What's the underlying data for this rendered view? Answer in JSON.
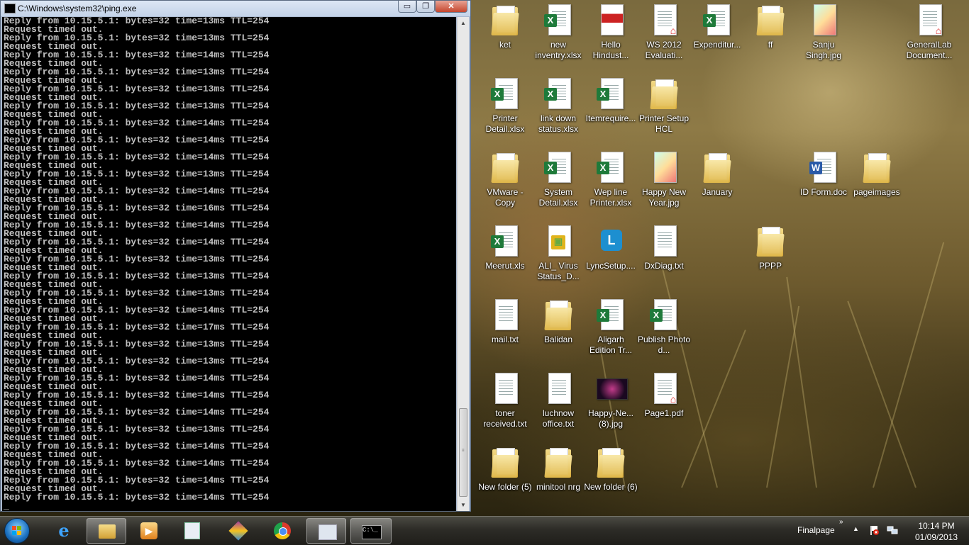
{
  "console": {
    "title": "C:\\Windows\\system32\\ping.exe",
    "buttons": {
      "minimize": "▭",
      "maximize": "❐",
      "close": "✕"
    },
    "output_lines": [
      "Reply from 10.15.5.1: bytes=32 time=13ms TTL=254",
      "Request timed out.",
      "Reply from 10.15.5.1: bytes=32 time=13ms TTL=254",
      "Request timed out.",
      "Reply from 10.15.5.1: bytes=32 time=14ms TTL=254",
      "Request timed out.",
      "Reply from 10.15.5.1: bytes=32 time=13ms TTL=254",
      "Request timed out.",
      "Reply from 10.15.5.1: bytes=32 time=13ms TTL=254",
      "Request timed out.",
      "Reply from 10.15.5.1: bytes=32 time=13ms TTL=254",
      "Request timed out.",
      "Reply from 10.15.5.1: bytes=32 time=14ms TTL=254",
      "Request timed out.",
      "Reply from 10.15.5.1: bytes=32 time=14ms TTL=254",
      "Request timed out.",
      "Reply from 10.15.5.1: bytes=32 time=14ms TTL=254",
      "Request timed out.",
      "Reply from 10.15.5.1: bytes=32 time=13ms TTL=254",
      "Request timed out.",
      "Reply from 10.15.5.1: bytes=32 time=14ms TTL=254",
      "Request timed out.",
      "Reply from 10.15.5.1: bytes=32 time=16ms TTL=254",
      "Request timed out.",
      "Reply from 10.15.5.1: bytes=32 time=14ms TTL=254",
      "Request timed out.",
      "Reply from 10.15.5.1: bytes=32 time=14ms TTL=254",
      "Request timed out.",
      "Reply from 10.15.5.1: bytes=32 time=13ms TTL=254",
      "Request timed out.",
      "Reply from 10.15.5.1: bytes=32 time=13ms TTL=254",
      "Request timed out.",
      "Reply from 10.15.5.1: bytes=32 time=13ms TTL=254",
      "Request timed out.",
      "Reply from 10.15.5.1: bytes=32 time=14ms TTL=254",
      "Request timed out.",
      "Reply from 10.15.5.1: bytes=32 time=17ms TTL=254",
      "Request timed out.",
      "Reply from 10.15.5.1: bytes=32 time=13ms TTL=254",
      "Request timed out.",
      "Reply from 10.15.5.1: bytes=32 time=13ms TTL=254",
      "Request timed out.",
      "Reply from 10.15.5.1: bytes=32 time=14ms TTL=254",
      "Request timed out.",
      "Reply from 10.15.5.1: bytes=32 time=14ms TTL=254",
      "Request timed out.",
      "Reply from 10.15.5.1: bytes=32 time=14ms TTL=254",
      "Request timed out.",
      "Reply from 10.15.5.1: bytes=32 time=13ms TTL=254",
      "Request timed out.",
      "Reply from 10.15.5.1: bytes=32 time=14ms TTL=254",
      "Request timed out.",
      "Reply from 10.15.5.1: bytes=32 time=14ms TTL=254",
      "Request timed out.",
      "Reply from 10.15.5.1: bytes=32 time=14ms TTL=254",
      "Request timed out.",
      "Reply from 10.15.5.1: bytes=32 time=14ms TTL=254",
      "_"
    ]
  },
  "desktop_icons": [
    {
      "label": "ket",
      "type": "folder"
    },
    {
      "label": "new inventry.xlsx",
      "type": "excel"
    },
    {
      "label": "Hello Hindust...",
      "type": "pdf-image"
    },
    {
      "label": "WS 2012 Evaluati...",
      "type": "pdf"
    },
    {
      "label": "Expenditur...",
      "type": "excel"
    },
    {
      "label": "ff",
      "type": "folder"
    },
    {
      "label": "Sanju Singh.jpg",
      "type": "image"
    },
    {
      "label": "GeneralLab Document...",
      "type": "pdf"
    },
    {
      "label": "Printer Detail.xlsx",
      "type": "excel"
    },
    {
      "label": "link down status.xlsx",
      "type": "excel"
    },
    {
      "label": "Itemrequire...",
      "type": "excel"
    },
    {
      "label": "Printer Setup HCL",
      "type": "folder"
    },
    {
      "label": "VMware - Copy",
      "type": "folder"
    },
    {
      "label": "System Detail.xlsx",
      "type": "excel"
    },
    {
      "label": "Wep line Printer.xlsx",
      "type": "excel"
    },
    {
      "label": "Happy New Year.jpg",
      "type": "image"
    },
    {
      "label": "January",
      "type": "folder"
    },
    {
      "label": "ID Form.doc",
      "type": "word"
    },
    {
      "label": "pageimages",
      "type": "folder"
    },
    {
      "label": "Meerut.xls",
      "type": "excel"
    },
    {
      "label": "ALI_ Virus Status_D...",
      "type": "ali"
    },
    {
      "label": "LyncSetup....",
      "type": "lync"
    },
    {
      "label": "DxDiag.txt",
      "type": "text"
    },
    {
      "label": "PPPP",
      "type": "folder"
    },
    {
      "label": "mail.txt",
      "type": "text"
    },
    {
      "label": "Balidan",
      "type": "folder"
    },
    {
      "label": "Aligarh Edition Tr...",
      "type": "excel"
    },
    {
      "label": "Publish Photo d...",
      "type": "excel"
    },
    {
      "label": "toner received.txt",
      "type": "text"
    },
    {
      "label": "luchnow office.txt",
      "type": "text"
    },
    {
      "label": "Happy-Ne... (8).jpg",
      "type": "dark-image"
    },
    {
      "label": "Page1.pdf",
      "type": "pdf"
    },
    {
      "label": "New folder (5)",
      "type": "folder"
    },
    {
      "label": "minitool nrg",
      "type": "folder"
    },
    {
      "label": "New folder (6)",
      "type": "folder"
    }
  ],
  "taskbar": {
    "pinned": [
      {
        "name": "internet-explorer-icon",
        "glyph": "e"
      },
      {
        "name": "windows-explorer-icon",
        "glyph": ""
      },
      {
        "name": "media-player-icon",
        "glyph": "▶"
      },
      {
        "name": "document-icon",
        "glyph": ""
      },
      {
        "name": "winrar-icon",
        "glyph": ""
      },
      {
        "name": "chrome-icon",
        "glyph": ""
      },
      {
        "name": "window-icon",
        "glyph": ""
      },
      {
        "name": "command-prompt-icon",
        "glyph": "C:\\_"
      }
    ],
    "toolbar_label": "Finalpage",
    "chevron": "»",
    "tray_arrow": "▲",
    "time": "10:14 PM",
    "date": "01/09/2013"
  }
}
